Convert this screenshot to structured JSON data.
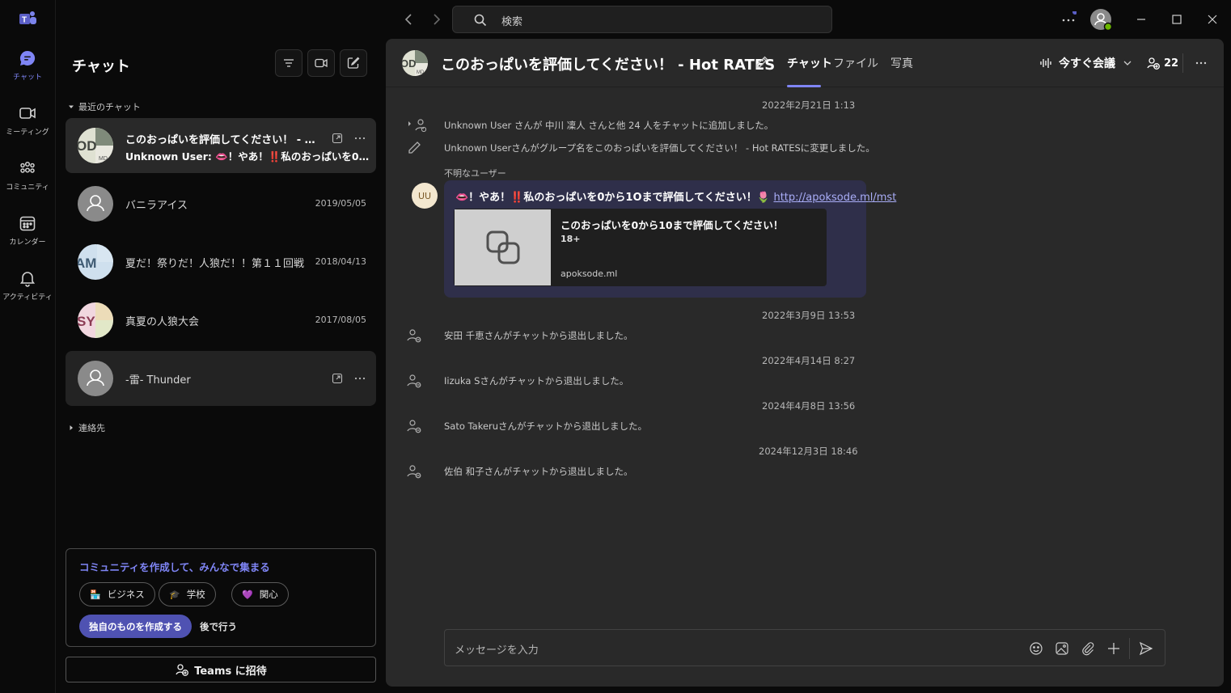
{
  "search": {
    "placeholder": "検索"
  },
  "rail": {
    "items": [
      {
        "label": "チャット",
        "icon": "chat-icon",
        "active": true
      },
      {
        "label": "ミーティング",
        "icon": "video-icon"
      },
      {
        "label": "コミュニティ",
        "icon": "community-icon"
      },
      {
        "label": "カレンダー",
        "icon": "calendar-icon"
      },
      {
        "label": "アクティビティ",
        "icon": "bell-icon"
      }
    ]
  },
  "chat_list": {
    "title": "チャット",
    "recent_label": "最近のチャット",
    "contacts_label": "連絡先",
    "items": [
      {
        "name": "このおっぱいを評価してください！ - Hot RATES",
        "preview": "Unknown User: 👄！やあ！‼️私のおっぱいを0から10まで評価してください！",
        "avatar_initials": "OD"
      },
      {
        "name": "バニラアイス",
        "date": "2019/05/05"
      },
      {
        "name": "夏だ！祭りだ！人狼だ！！第１１回戦",
        "date": "2018/04/13",
        "avatar_initials": "AM"
      },
      {
        "name": "真夏の人狼大会",
        "date": "2017/08/05",
        "avatar_initials": "SY"
      },
      {
        "name": "-雷- Thunder"
      }
    ]
  },
  "community": {
    "title": "コミュニティを作成して、みんなで集まる",
    "pills": [
      {
        "label": "ビジネス",
        "emoji": "🏪"
      },
      {
        "label": "学校",
        "emoji": "🎓"
      },
      {
        "label": "関心",
        "emoji": "💜"
      }
    ],
    "create_label": "独自のものを作成する",
    "later_label": "後で行う"
  },
  "invite_label": "Teams に招待",
  "header": {
    "title": "このおっぱいを評価してください！ - Hot RATES",
    "avatar_initials": "OD",
    "tabs": [
      "チャット",
      "ファイル",
      "写真"
    ],
    "meet_now": "今すぐ会議",
    "participants": "22"
  },
  "messages": {
    "ts1": "2022年2月21日 1:13",
    "sys1": "Unknown User さんが 中川 凜人 さんと他 24 人をチャットに追加しました。",
    "sys2": "Unknown Userさんがグループ名をこのおっぱいを評価してください！ - Hot RATESに変更しました。",
    "sender": "不明なユーザー",
    "sender_initials": "UU",
    "text": "👄！やあ！‼️私のおっぱいを0から1Oまで評価してください！🌷",
    "link": "http://apoksode.ml/mst",
    "card_title": "このおっぱいを0から10まで評価してください！",
    "card_sub": "18+",
    "card_domain": "apoksode.ml",
    "ts2": "2022年3月9日 13:53",
    "sys3": "安田 千恵さんがチャットから退出しました。",
    "ts3": "2022年4月14日 8:27",
    "sys4": "Iizuka Sさんがチャットから退出しました。",
    "ts4": "2024年4月8日 13:56",
    "sys5": "Sato Takeruさんがチャットから退出しました。",
    "ts5": "2024年12月3日 18:46",
    "sys6": "佐伯 和子さんがチャットから退出しました。"
  },
  "composer": {
    "placeholder": "メッセージを入力"
  },
  "colors": {
    "accent": "#7f85f5",
    "accent_button": "#4f52b2",
    "bubble": "#2f2f4a",
    "panel": "#292929",
    "background": "#0a0a0a"
  }
}
